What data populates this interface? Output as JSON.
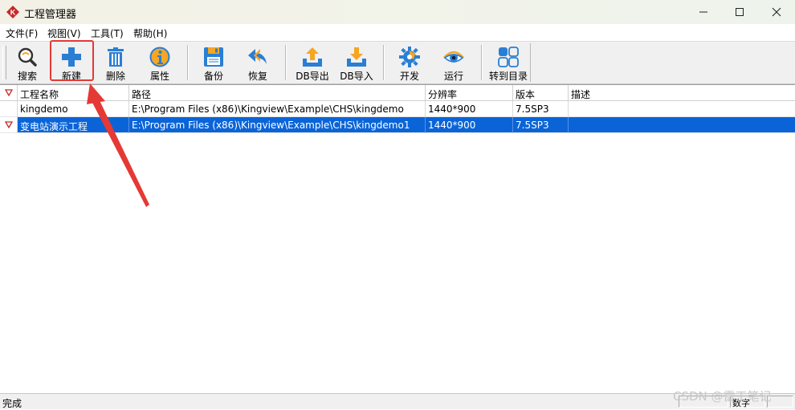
{
  "window": {
    "title": "工程管理器"
  },
  "menu": [
    "文件(F)",
    "视图(V)",
    "工具(T)",
    "帮助(H)"
  ],
  "toolbar": [
    {
      "label": "搜索",
      "icon": "magnifier-icon"
    },
    {
      "label": "新建",
      "icon": "plus-icon"
    },
    {
      "label": "删除",
      "icon": "trash-icon"
    },
    {
      "label": "属性",
      "icon": "info-icon"
    },
    {
      "label": "备份",
      "icon": "floppy-disk-icon"
    },
    {
      "label": "恢复",
      "icon": "undo-arrow-icon"
    },
    {
      "label": "DB导出",
      "icon": "tray-upload-icon"
    },
    {
      "label": "DB导入",
      "icon": "tray-download-icon"
    },
    {
      "label": "开发",
      "icon": "develop-gear-icon"
    },
    {
      "label": "运行",
      "icon": "eye-icon"
    },
    {
      "label": "转到目录",
      "icon": "grid-directory-icon"
    }
  ],
  "table": {
    "columns": [
      "工程名称",
      "路径",
      "分辨率",
      "版本",
      "描述"
    ],
    "rows": [
      {
        "name": "kingdemo",
        "path": "E:\\Program Files (x86)\\Kingview\\Example\\CHS\\kingdemo",
        "resolution": "1440*900",
        "version": "7.5SP3",
        "desc": "",
        "selected": false
      },
      {
        "name": "变电站演示工程",
        "path": "E:\\Program Files (x86)\\Kingview\\Example\\CHS\\kingdemo1",
        "resolution": "1440*900",
        "version": "7.5SP3",
        "desc": "",
        "selected": true
      }
    ]
  },
  "status": {
    "left": "完成",
    "num": "数字"
  },
  "watermark": "CSDN @雷工笔记",
  "colors": {
    "selection": "#0a64d8",
    "highlight_box": "#e53935",
    "arrow": "#e53935",
    "icon_blue": "#2a7fd4",
    "icon_orange": "#f5a623"
  }
}
